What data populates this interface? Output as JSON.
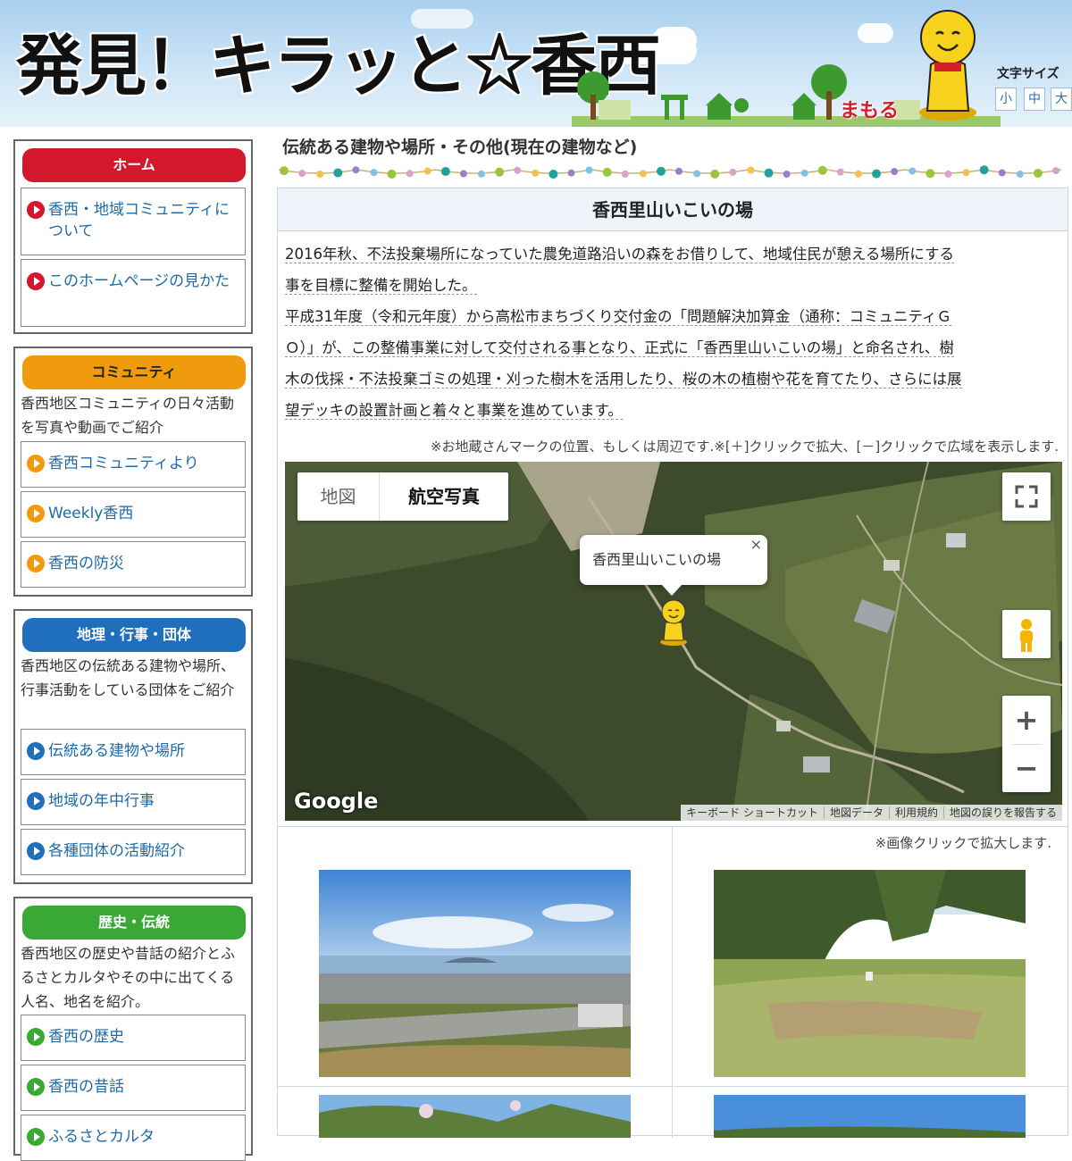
{
  "header": {
    "site_title": "発見！キラッと☆香西",
    "mamoru_label": "まもる",
    "font_size": {
      "label": "文字サイズ",
      "options": [
        "小",
        "中",
        "大"
      ]
    }
  },
  "sidebar": {
    "sections": [
      {
        "heading": "ホーム",
        "color": "#d3182b",
        "description": "",
        "links": [
          "香西・地域コミュニティについて",
          "このホームページの見かた"
        ]
      },
      {
        "heading": "コミュニティ",
        "color": "#f09a0e",
        "description": "香西地区コミュニティの日々活動を写真や動画でご紹介",
        "links": [
          "香西コミュニティより",
          "Weekly香西",
          "香西の防災"
        ]
      },
      {
        "heading": "地理・行事・団体",
        "color": "#1f6fbd",
        "description": "香西地区の伝統ある建物や場所、行事活動をしている団体をご紹介",
        "links": [
          "伝統ある建物や場所",
          "地域の年中行事",
          "各種団体の活動紹介"
        ]
      },
      {
        "heading": "歴史・伝統",
        "color": "#3aa835",
        "description": "香西地区の歴史や昔話の紹介とふるさとカルタやその中に出てくる人名、地名を紹介。",
        "links": [
          "香西の歴史",
          "香西の昔話",
          "ふるさとカルタ"
        ]
      }
    ]
  },
  "main": {
    "page_title": "伝統ある建物や場所・その他(現在の建物など)",
    "content_title": "香西里山いこいの場",
    "paragraph1": [
      "2016年秋、不法投棄場所になっていた農免道路沿いの森をお借りして、地域住民が憩える場所にする",
      "事を目標に整備を開始した。"
    ],
    "paragraph2": [
      "平成31年度（令和元年度）から高松市まちづくり交付金の「問題解決加算金（通称：コミュニティＧ",
      "Ｏ）」が、この整備事業に対して交付される事となり、正式に「香西里山いこいの場」と命名され、樹",
      "木の伐採・不法投棄ゴミの処理・刈った樹木を活用したり、桜の木の植樹や花を育てたり、さらには展",
      "望デッキの設置計画と着々と事業を進めています。"
    ],
    "map_note": "※お地蔵さんマークの位置、もしくは周辺です.※[＋]クリックで拡大、[－]クリックで広域を表示します.",
    "map": {
      "type_map": "地図",
      "type_satellite": "航空写真",
      "info_title": "香西里山いこいの場",
      "info_close": "×",
      "google": "Google",
      "zoom_in": "+",
      "zoom_out": "−",
      "footer_links": [
        "キーボード ショートカット",
        "地図データ",
        "利用規約",
        "地図の誤りを報告する"
      ]
    },
    "photo_note": "※画像クリックで拡大します."
  },
  "colors": {
    "header_sky": "#c7e1f5",
    "link_text": "#1d6aa5",
    "content_title_bg": "#eef4fa"
  }
}
